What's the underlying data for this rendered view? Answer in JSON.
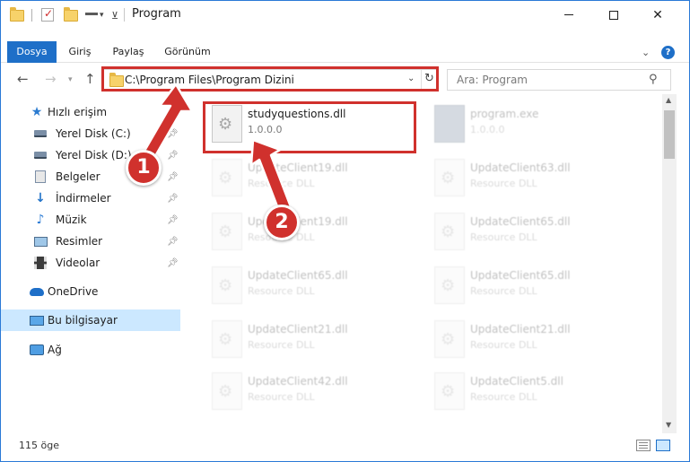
{
  "window": {
    "title": "Program"
  },
  "ribbon": {
    "tabs": [
      "Dosya",
      "Giriş",
      "Paylaş",
      "Görünüm"
    ],
    "help": "?"
  },
  "address": {
    "path": "C:\\Program Files\\Program Dizini"
  },
  "search": {
    "placeholder": "Ara: Program"
  },
  "nav": {
    "items": [
      {
        "label": "Hızlı erişim",
        "icon": "star-icon"
      },
      {
        "label": "Yerel Disk (C:)",
        "icon": "drive-icon"
      },
      {
        "label": "Yerel Disk (D:)",
        "icon": "drive-icon"
      },
      {
        "label": "Belgeler",
        "icon": "documents-icon"
      },
      {
        "label": "İndirmeler",
        "icon": "download-icon"
      },
      {
        "label": "Müzik",
        "icon": "music-icon"
      },
      {
        "label": "Resimler",
        "icon": "pictures-icon"
      },
      {
        "label": "Videolar",
        "icon": "videos-icon"
      },
      {
        "label": "OneDrive",
        "icon": "cloud-icon"
      },
      {
        "label": "Bu bilgisayar",
        "icon": "computer-icon"
      },
      {
        "label": "Ağ",
        "icon": "network-icon"
      }
    ]
  },
  "files": [
    {
      "name": "studyquestions.dll",
      "sub": "1.0.0.0"
    },
    {
      "name": "program.exe",
      "sub": "1.0.0.0"
    },
    {
      "name": "UpdateClient19.dll",
      "sub": "Resource DLL"
    },
    {
      "name": "UpdateClient63.dll",
      "sub": "Resource DLL"
    },
    {
      "name": "UpdateClient19.dll",
      "sub": "Resource DLL"
    },
    {
      "name": "UpdateClient65.dll",
      "sub": "Resource DLL"
    },
    {
      "name": "UpdateClient65.dll",
      "sub": "Resource DLL"
    },
    {
      "name": "UpdateClient65.dll",
      "sub": "Resource DLL"
    },
    {
      "name": "UpdateClient21.dll",
      "sub": "Resource DLL"
    },
    {
      "name": "UpdateClient21.dll",
      "sub": "Resource DLL"
    },
    {
      "name": "UpdateClient42.dll",
      "sub": "Resource DLL"
    },
    {
      "name": "UpdateClient5.dll",
      "sub": "Resource DLL"
    }
  ],
  "status": {
    "count": "115 öge"
  },
  "callouts": [
    "1",
    "2"
  ],
  "colors": {
    "accent": "#1e6fc8",
    "highlight": "#d0312d",
    "selection": "#cce8ff"
  }
}
